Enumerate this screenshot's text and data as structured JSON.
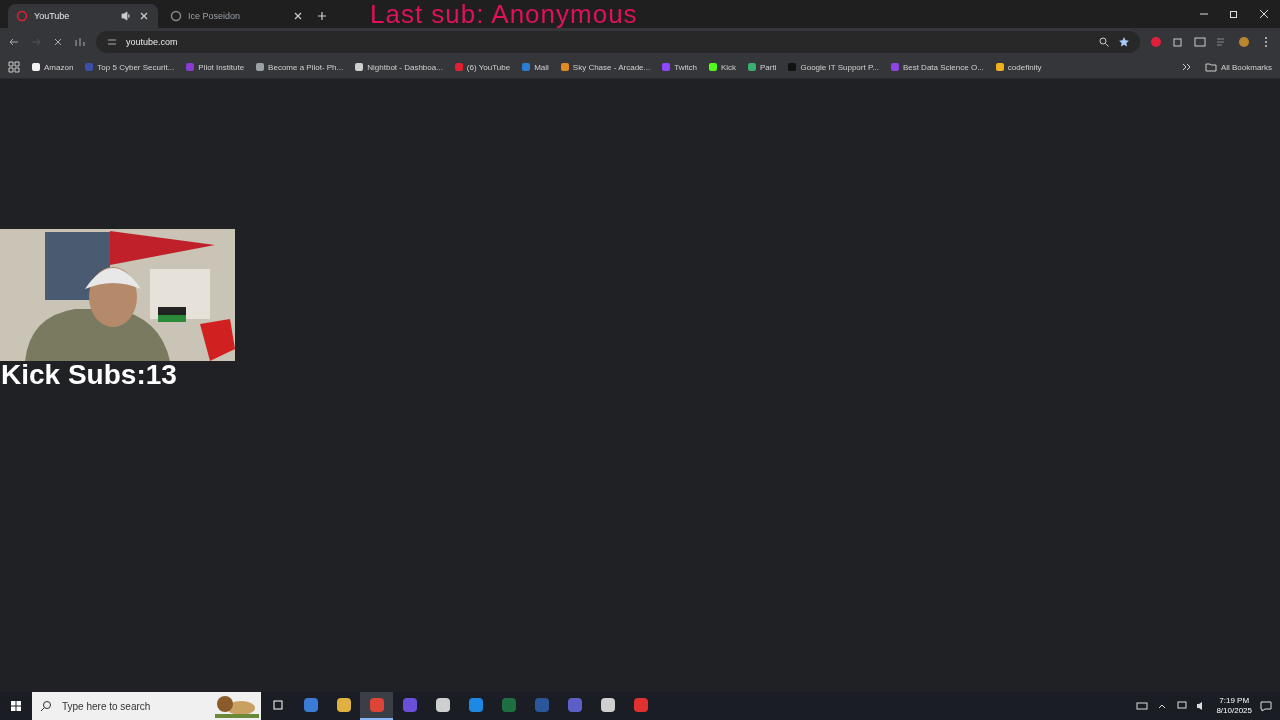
{
  "tabs": [
    {
      "title": "YouTube",
      "selected": true,
      "audio": true
    },
    {
      "title": "Ice Poseidon",
      "selected": false,
      "audio": false
    }
  ],
  "address": "youtube.com",
  "bookmarks": [
    {
      "label": "Amazon",
      "color": "#f2f2f2"
    },
    {
      "label": "Top 5 Cyber Securit...",
      "color": "#3b4fa8"
    },
    {
      "label": "Pilot Institute",
      "color": "#8a3ad0"
    },
    {
      "label": "Become a Pilot- Ph...",
      "color": "#9aa0a6"
    },
    {
      "label": "Nightbot - Dashboa...",
      "color": "#cfcfcf"
    },
    {
      "label": "(6) YouTube",
      "color": "#e02030"
    },
    {
      "label": "Mail",
      "color": "#2a7fd4"
    },
    {
      "label": "Sky Chase - Arcade...",
      "color": "#e08a20"
    },
    {
      "label": "Twitch",
      "color": "#9146ff"
    },
    {
      "label": "Kick",
      "color": "#53fc18"
    },
    {
      "label": "Parti",
      "color": "#3ab070"
    },
    {
      "label": "Google IT Support P...",
      "color": "#111111"
    },
    {
      "label": "Best Data Science O...",
      "color": "#8e44e0"
    },
    {
      "label": "codefinity",
      "color": "#f0b020"
    }
  ],
  "all_bookmarks": "All Bookmarks",
  "overlay": {
    "last_sub": "Last sub: Anonymous",
    "kick_subs": "Kick Subs:13"
  },
  "taskbar": {
    "search_placeholder": "Type here to search",
    "apps": [
      {
        "color": "#3a7bd5",
        "selected": false
      },
      {
        "color": "#e0b040",
        "selected": false
      },
      {
        "color": "#db4437",
        "selected": true
      },
      {
        "color": "#6a4fd8",
        "selected": false
      },
      {
        "color": "#cfcfcf",
        "selected": false
      },
      {
        "color": "#1e88e5",
        "selected": false
      },
      {
        "color": "#1d6f42",
        "selected": false
      },
      {
        "color": "#2b579a",
        "selected": false
      },
      {
        "color": "#5b5fc7",
        "selected": false
      },
      {
        "color": "#d0d0d0",
        "selected": false
      },
      {
        "color": "#e03030",
        "selected": false
      }
    ],
    "time": "7:19 PM",
    "date": "8/10/2025"
  }
}
